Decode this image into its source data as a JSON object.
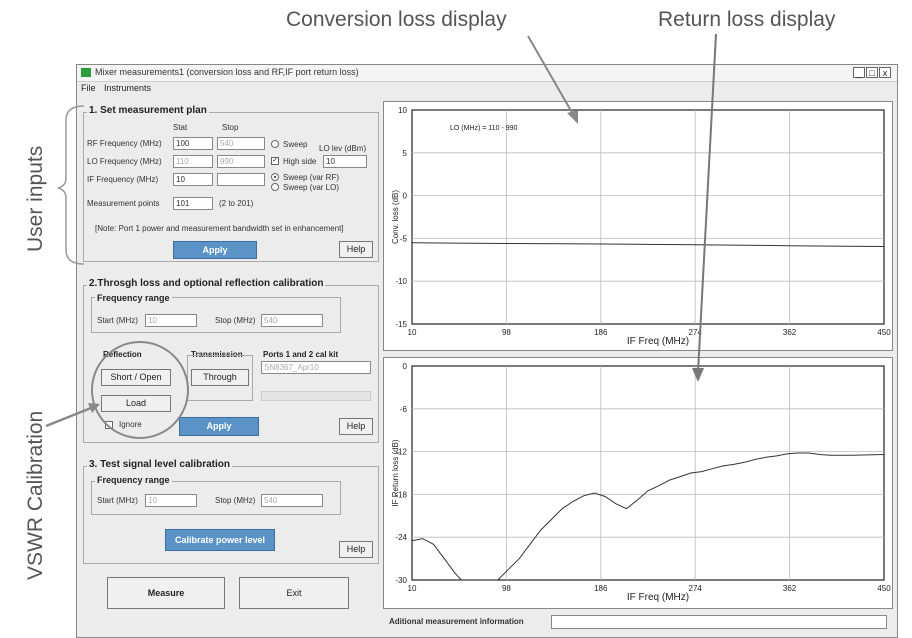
{
  "annotations": {
    "conversion_loss_display": "Conversion loss display",
    "return_loss_display": "Return loss display",
    "user_inputs": "User inputs",
    "vswr_calibration": "VSWR Calibration"
  },
  "window": {
    "title": "Mixer measurements1 (conversion loss and RF,IF port return loss)",
    "controls": [
      "_",
      "□",
      "x"
    ]
  },
  "menu": [
    "File",
    "Instruments"
  ],
  "section1": {
    "title": "1. Set measurement plan",
    "col_start": "Stat",
    "col_stop": "Stop",
    "rf_label": "RF Frequency (MHz)",
    "rf_start": "100",
    "rf_stop": "540",
    "lo_label": "LO Frequency (MHz)",
    "lo_start": "110",
    "lo_stop": "990",
    "if_label": "IF Frequency (MHz)",
    "if_start": "10",
    "if_stop": "",
    "sweep_label": "Sweep",
    "high_side_label": "High side",
    "lo_lev_label": "LO lev (dBm)",
    "lo_lev": "10",
    "sweep_var_rf": "Sweep (var RF)",
    "sweep_var_lo": "Sweep (var LO)",
    "points_label": "Measurement points",
    "points": "101",
    "points_range": "(2 to 201)",
    "note": "[Note: Port 1 power and measurement bandwidth  set in enhancement]",
    "apply": "Apply",
    "help": "Help"
  },
  "section2": {
    "title": "2.Throsgh loss and optional reflection calibration",
    "freq_range": "Frequency range",
    "start_label": "Start (MHz)",
    "start": "10",
    "stop_label": "Stop (MHz)",
    "stop": "540",
    "reflection": "Reflection",
    "transmission": "Transmission",
    "cal_kit_label": "Ports 1  and 2 cal kit",
    "cal_kit": "SN8367_Apr10",
    "short_open": "Short / Open",
    "through": "Through",
    "load": "Load",
    "ignore": "Ignore",
    "apply": "Apply",
    "help": "Help"
  },
  "section3": {
    "title": "3. Test signal level calibration",
    "freq_range": "Frequency range",
    "start_label": "Start (MHz)",
    "start": "10",
    "stop_label": "Stop (MHz)",
    "stop": "540",
    "calibrate": "Calibrate power level",
    "help": "Help"
  },
  "bottom": {
    "measure": "Measure",
    "exit": "Exit",
    "info_label": "Aditional measurement information"
  },
  "chart_data": [
    {
      "type": "line",
      "annotation": "LO (MHz) = 110 - 990",
      "xlabel": "IF Freq (MHz)",
      "ylabel": "Conv. loss (dB)",
      "xlim": [
        10,
        450
      ],
      "ylim": [
        -15,
        10
      ],
      "xticks": [
        "10",
        "98",
        "186",
        "274",
        "362",
        "450"
      ],
      "yticks": [
        "10",
        "5",
        "0",
        "-5",
        "-10",
        "-15"
      ],
      "grid": true,
      "series": [
        {
          "x": [
            10,
            50,
            98,
            150,
            186,
            230,
            274,
            320,
            362,
            400,
            450
          ],
          "y": [
            -5.5,
            -5.55,
            -5.6,
            -5.62,
            -5.65,
            -5.7,
            -5.75,
            -5.8,
            -5.85,
            -5.9,
            -5.95
          ]
        }
      ]
    },
    {
      "type": "line",
      "xlabel": "IF Freq (MHz)",
      "ylabel": "IF Return loss (dB)",
      "xlim": [
        10,
        450
      ],
      "ylim": [
        -30,
        0
      ],
      "xticks": [
        "10",
        "98",
        "186",
        "274",
        "362",
        "450"
      ],
      "yticks": [
        "0",
        "-6",
        "-12",
        "-18",
        "-24",
        "-30"
      ],
      "grid": true,
      "series": [
        {
          "x": [
            10,
            20,
            30,
            40,
            50,
            56,
            90,
            100,
            110,
            120,
            130,
            140,
            150,
            160,
            170,
            180,
            190,
            200,
            210,
            220,
            230,
            240,
            250,
            260,
            270,
            280,
            290,
            300,
            310,
            320,
            330,
            340,
            350,
            360,
            370,
            380,
            390,
            400,
            420,
            450
          ],
          "y": [
            -24.5,
            -24.2,
            -25,
            -27,
            -29,
            -30,
            -30,
            -28.5,
            -27,
            -25,
            -23,
            -21.5,
            -20,
            -19,
            -18.2,
            -17.8,
            -18.3,
            -19.3,
            -20,
            -18.8,
            -17.5,
            -16.8,
            -16,
            -15.5,
            -15,
            -14.8,
            -14.4,
            -14,
            -13.8,
            -13.5,
            -13.1,
            -12.8,
            -12.6,
            -12.3,
            -12.2,
            -12.2,
            -12.4,
            -12.5,
            -12.5,
            -12.4
          ]
        }
      ]
    }
  ]
}
